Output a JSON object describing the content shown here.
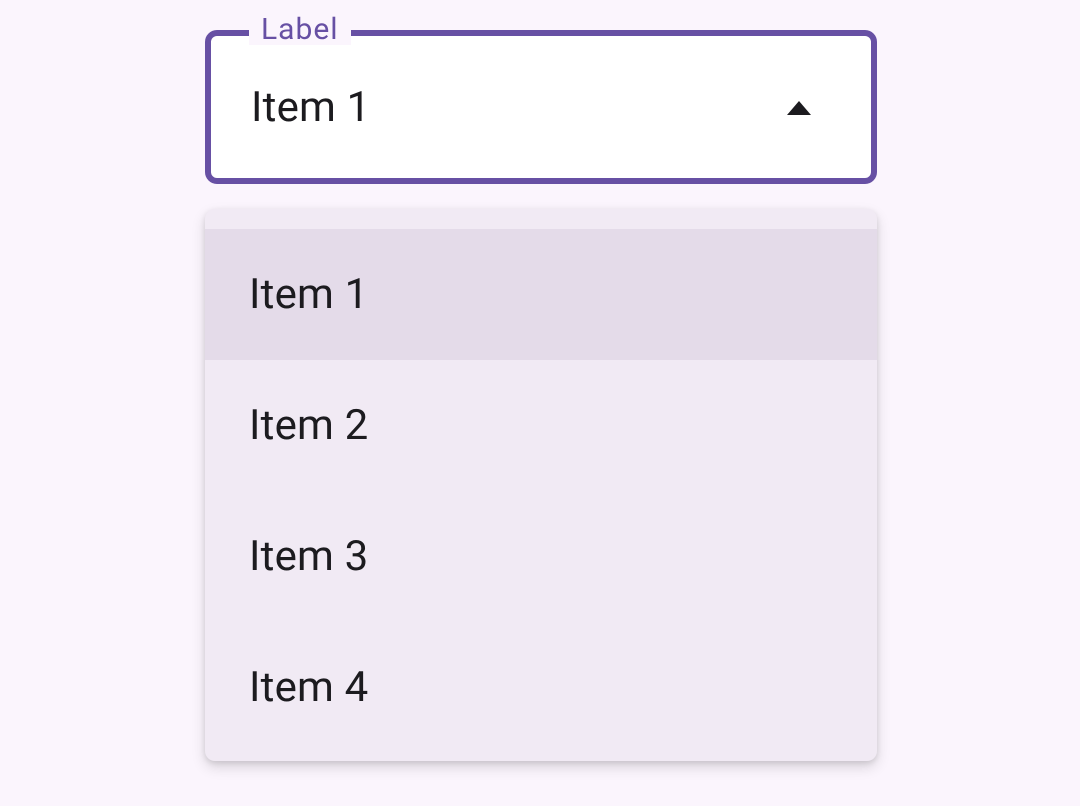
{
  "colors": {
    "primary": "#6750a4",
    "surface": "#f1eaf4",
    "selectedItem": "#e4dbe9",
    "background": "#fbf5fd",
    "text": "#1c1b1f"
  },
  "select": {
    "label": "Label",
    "value": "Item 1",
    "expanded": true,
    "arrowIcon": "arrow-drop-up-icon"
  },
  "menu": {
    "selectedIndex": 0,
    "items": [
      {
        "label": "Item 1"
      },
      {
        "label": "Item 2"
      },
      {
        "label": "Item 3"
      },
      {
        "label": "Item 4"
      }
    ]
  }
}
